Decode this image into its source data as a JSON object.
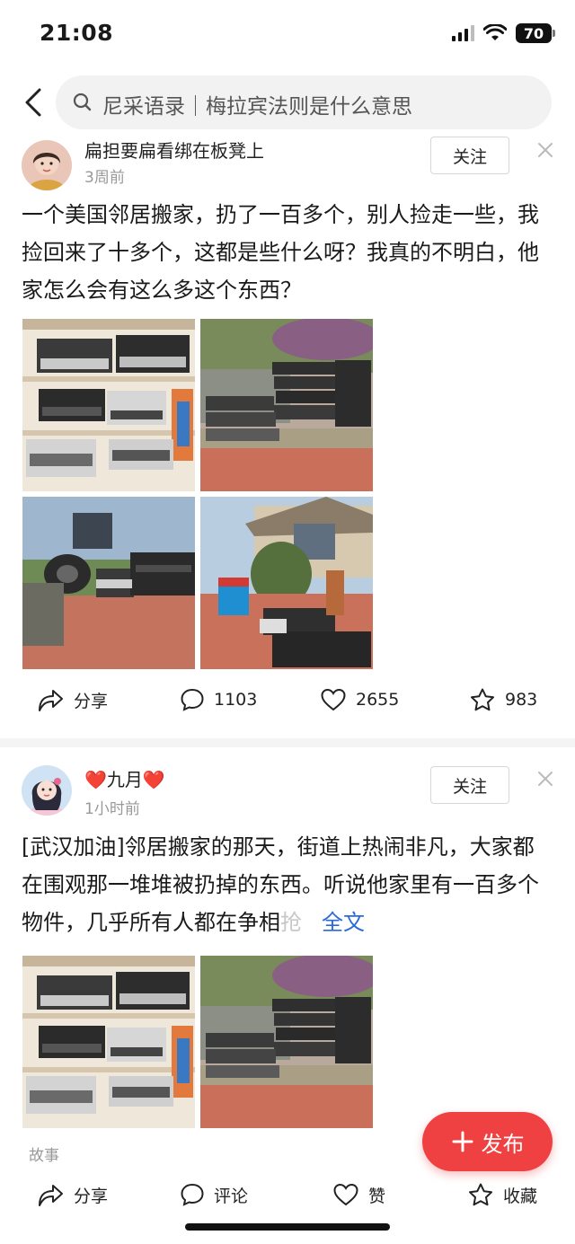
{
  "status_bar": {
    "time": "21:08",
    "battery": "70"
  },
  "search": {
    "placeholder": "尼采语录｜梅拉宾法则是什么意思"
  },
  "posts": [
    {
      "username": "扁担要扁看绑在板凳上",
      "time": "3周前",
      "follow_label": "关注",
      "text": "一个美国邻居搬家，扔了一百多个，别人捡走一些，我捡回来了十多个，这都是些什么呀？我真的不明白，他家怎么会有这么多这个东西？",
      "actions": {
        "share": "分享",
        "comments": "1103",
        "likes": "2655",
        "favorites": "983"
      }
    },
    {
      "username": "❤️九月❤️",
      "time": "1小时前",
      "follow_label": "关注",
      "text_main": "[武汉加油]邻居搬家的那天，街道上热闹非凡，大家都在围观那一堆堆被扔掉的东西。听说他家里有一百多个物件，几乎所有人都在争相",
      "text_fade": "抢",
      "full_text_link": "全文",
      "tag": "故事",
      "actions": {
        "share": "分享",
        "comment": "评论",
        "like": "赞",
        "favorite": "收藏"
      }
    }
  ],
  "publish_button": "发布",
  "colors": {
    "accent": "#f04142",
    "link": "#2a6ad8",
    "muted": "#999999"
  }
}
